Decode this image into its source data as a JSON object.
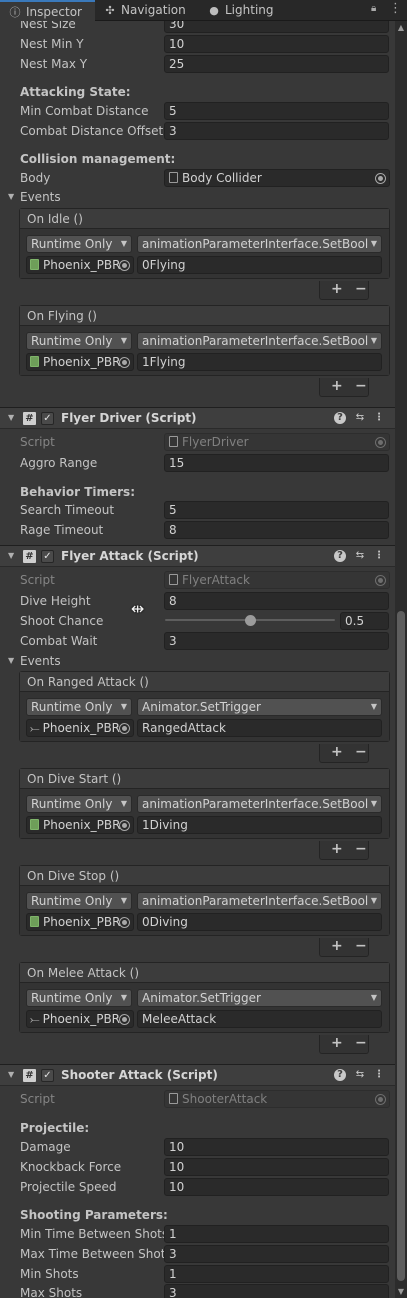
{
  "tabs": [
    {
      "label": "Inspector",
      "icon": "info-icon"
    },
    {
      "label": "Navigation",
      "icon": "navigation-icon"
    },
    {
      "label": "Lighting",
      "icon": "lightbulb-icon"
    }
  ],
  "top_fields": [
    {
      "label": "Nest Size",
      "value": "30"
    },
    {
      "label": "Nest Min Y",
      "value": "10"
    },
    {
      "label": "Nest Max Y",
      "value": "25"
    }
  ],
  "attacking_state": {
    "header": "Attacking State:",
    "fields": [
      {
        "label": "Min Combat Distance",
        "value": "5"
      },
      {
        "label": "Combat Distance Offset",
        "value": "3"
      }
    ]
  },
  "collision": {
    "header": "Collision management:",
    "body_label": "Body",
    "body_value": "Body Collider"
  },
  "events_label": "Events",
  "events_1": [
    {
      "title": "On Idle ()",
      "mode": "Runtime Only",
      "function": "animationParameterInterface.SetBool",
      "object": "Phoenix_PBR",
      "arg": "0Flying"
    },
    {
      "title": "On Flying ()",
      "mode": "Runtime Only",
      "function": "animationParameterInterface.SetBool",
      "object": "Phoenix_PBR",
      "arg": "1Flying"
    }
  ],
  "flyer_driver": {
    "title": "Flyer Driver (Script)",
    "script_label": "Script",
    "script_value": "FlyerDriver",
    "aggro_label": "Aggro Range",
    "aggro_value": "15",
    "timers_header": "Behavior Timers:",
    "timers": [
      {
        "label": "Search Timeout",
        "value": "5"
      },
      {
        "label": "Rage Timeout",
        "value": "8"
      }
    ]
  },
  "flyer_attack": {
    "title": "Flyer Attack (Script)",
    "script_label": "Script",
    "script_value": "FlyerAttack",
    "dive_label": "Dive Height",
    "dive_value": "8",
    "shoot_label": "Shoot Chance",
    "shoot_value": "0.5",
    "shoot_fraction": 0.5,
    "combat_label": "Combat Wait",
    "combat_value": "3"
  },
  "events_2": [
    {
      "title": "On Ranged Attack ()",
      "mode": "Runtime Only",
      "function": "Animator.SetTrigger",
      "object": "Phoenix_PBR",
      "arg": "RangedAttack"
    },
    {
      "title": "On Dive Start ()",
      "mode": "Runtime Only",
      "function": "animationParameterInterface.SetBool",
      "object": "Phoenix_PBR",
      "arg": "1Diving"
    },
    {
      "title": "On Dive Stop ()",
      "mode": "Runtime Only",
      "function": "animationParameterInterface.SetBool",
      "object": "Phoenix_PBR",
      "arg": "0Diving"
    },
    {
      "title": "On Melee Attack ()",
      "mode": "Runtime Only",
      "function": "Animator.SetTrigger",
      "object": "Phoenix_PBR",
      "arg": "MeleeAttack"
    }
  ],
  "shooter_attack": {
    "title": "Shooter Attack (Script)",
    "script_label": "Script",
    "script_value": "ShooterAttack",
    "projectile_header": "Projectile:",
    "projectile": [
      {
        "label": "Damage",
        "value": "10"
      },
      {
        "label": "Knockback Force",
        "value": "10"
      },
      {
        "label": "Projectile Speed",
        "value": "10"
      }
    ],
    "shooting_header": "Shooting Parameters:",
    "shooting": [
      {
        "label": "Min Time Between Shots",
        "value": "1"
      },
      {
        "label": "Max Time Between Shots",
        "value": "3"
      },
      {
        "label": "Min Shots",
        "value": "1"
      },
      {
        "label": "Max Shots",
        "value": "3"
      }
    ]
  },
  "plus_label": "+",
  "minus_label": "−",
  "colors": {
    "accent": "#3a79bb",
    "background": "#383838",
    "field": "#2a2a2a",
    "component_header": "#3e3e3e"
  }
}
